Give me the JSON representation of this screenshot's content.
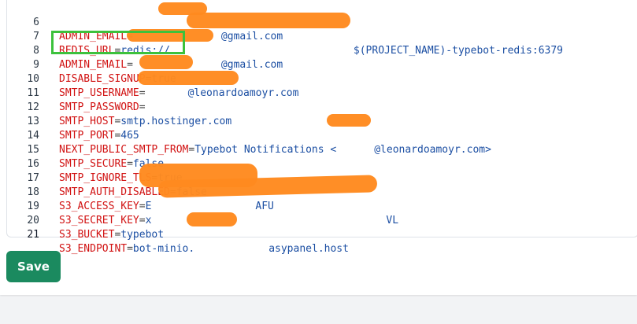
{
  "editor": {
    "lines": [
      {
        "num": "6",
        "key": "ADMIN_EMAIL",
        "op": "=",
        "val": "@gmail.com"
      },
      {
        "num": "7",
        "key": "REDIS_URL",
        "op": "=",
        "val": "redis://",
        "val2": "$(PROJECT_NAME)-typebot-redis:6379"
      },
      {
        "num": "8",
        "key": "ADMIN_EMAIL",
        "op": "=",
        "val": "@gmail.com"
      },
      {
        "num": "9",
        "key": "DISABLE_SIGNUP",
        "op": "=",
        "val": "true"
      },
      {
        "num": "10",
        "key": "SMTP_USERNAME",
        "op": "=",
        "val": "@leonardoamoyr.com"
      },
      {
        "num": "11",
        "key": "SMTP_PASSWORD",
        "op": "=",
        "val": ""
      },
      {
        "num": "12",
        "key": "SMTP_HOST",
        "op": "=",
        "val": "smtp.hostinger.com"
      },
      {
        "num": "13",
        "key": "SMTP_PORT",
        "op": "=",
        "val": "465"
      },
      {
        "num": "14",
        "key": "NEXT_PUBLIC_SMTP_FROM",
        "op": "=",
        "val": "Typebot Notifications <",
        "val2": "@leonardoamoyr.com>"
      },
      {
        "num": "15",
        "key": "SMTP_SECURE",
        "op": "=",
        "val": "false"
      },
      {
        "num": "16",
        "key": "SMTP_IGNORE_TLS",
        "op": "=",
        "val": "true"
      },
      {
        "num": "17",
        "key": "SMTP_AUTH_DISABLED",
        "op": "=",
        "val": "false"
      },
      {
        "num": "18",
        "key": "S3_ACCESS_KEY",
        "op": "=",
        "val": "E",
        "val2": "AFU"
      },
      {
        "num": "19",
        "key": "S3_SECRET_KEY",
        "op": "=",
        "val": "x",
        "val2": "VL"
      },
      {
        "num": "20",
        "key": "S3_BUCKET",
        "op": "=",
        "val": "typebot"
      },
      {
        "num": "21",
        "key": "S3_ENDPOINT",
        "op": "=",
        "val": "bot-minio.",
        "val2": "asypanel.host"
      }
    ]
  },
  "actions": {
    "save_label": "Save"
  },
  "colors": {
    "key": "#d11212",
    "value": "#1c4fa3",
    "save_button": "#1b8a5f",
    "highlight_box": "#3cc13c",
    "redaction": "#ff8a1f"
  }
}
